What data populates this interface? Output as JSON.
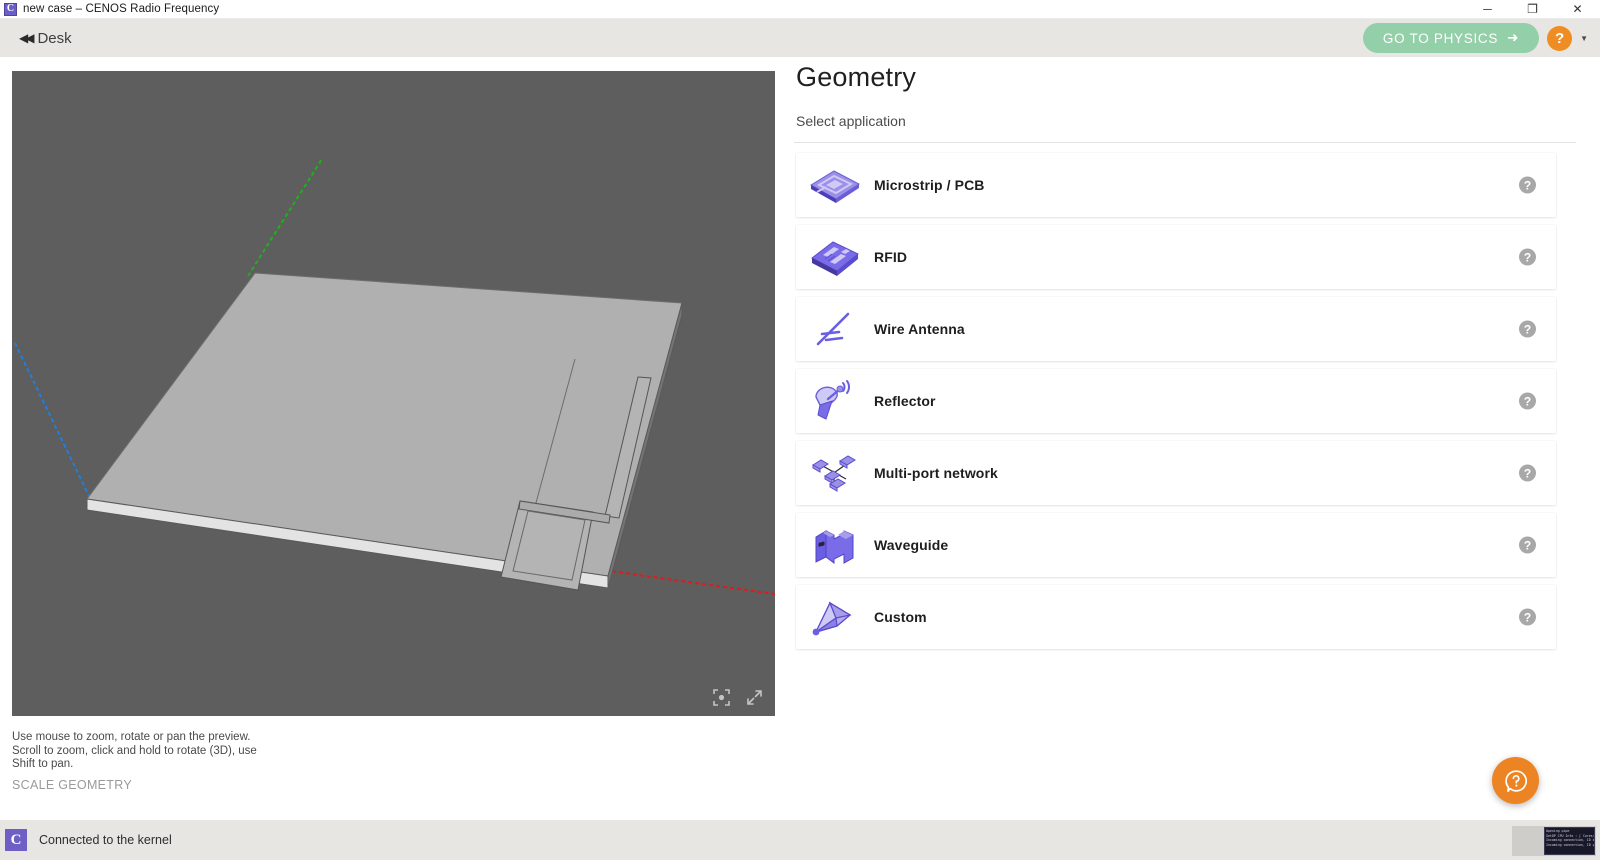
{
  "window": {
    "icon": "cenos-logo-icon",
    "title": "new case – CENOS Radio Frequency",
    "controls": {
      "minimize": "─",
      "maximize": "❐",
      "close": "✕"
    }
  },
  "toolbar": {
    "back_arrow": "◀◀",
    "back_label": "Desk",
    "physics_label": "GO TO PHYSICS",
    "physics_arrow": "➜",
    "physics_color": "#93cfa8",
    "help_badge": "?",
    "help_badge_color": "#f08c24",
    "caret": "▼"
  },
  "viewport": {
    "background_color": "#5e5e5e",
    "model": "pcb-patch-antenna",
    "axes": [
      {
        "name": "x-axis",
        "color": "#e01b1b"
      },
      {
        "name": "y-axis",
        "color": "#1bb21b"
      },
      {
        "name": "z-axis",
        "color": "#1f7fe0"
      }
    ],
    "controls": [
      {
        "name": "center-view-icon",
        "label": "center view"
      },
      {
        "name": "fullscreen-icon",
        "label": "fullscreen"
      }
    ],
    "hint_lines": [
      "Use mouse to zoom, rotate or pan the preview.",
      "Scroll to zoom, click and hold to rotate (3D), use",
      "Shift to pan."
    ],
    "scale_link": "SCALE GEOMETRY"
  },
  "panel": {
    "title": "Geometry",
    "subtitle": "Select application",
    "help_symbol": "?",
    "applications": [
      {
        "label": "Microstrip / PCB",
        "icon": "microstrip-pcb-icon"
      },
      {
        "label": "RFID",
        "icon": "rfid-icon"
      },
      {
        "label": "Wire Antenna",
        "icon": "wire-antenna-icon"
      },
      {
        "label": "Reflector",
        "icon": "reflector-dish-icon"
      },
      {
        "label": "Multi-port network",
        "icon": "multi-port-network-icon"
      },
      {
        "label": "Waveguide",
        "icon": "waveguide-icon"
      },
      {
        "label": "Custom",
        "icon": "custom-cone-icon"
      }
    ]
  },
  "fab": {
    "name": "help-chat-button",
    "symbol": "?",
    "color": "#ec8423"
  },
  "statusbar": {
    "logo": "C",
    "logo_color": "#6e5fc4",
    "text": "Connected to the kernel",
    "console_lines": [
      "Opening pipe",
      "GetDP CPU Info : [ Cores: 2m",
      "Incoming connection, ID back",
      "Incoming connection, ID pol"
    ]
  }
}
